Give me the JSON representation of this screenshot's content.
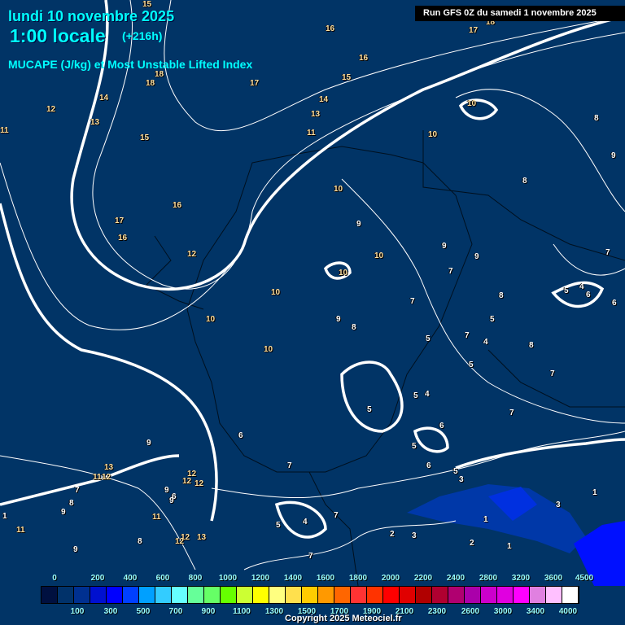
{
  "header": {
    "date": "lundi 10 novembre 2025",
    "time": "1:00 locale",
    "lead": "(+216h)",
    "parameter": "MUCAPE (J/kg) et Most Unstable Lifted Index",
    "run": "Run GFS 0Z du samedi 1 novembre 2025"
  },
  "map": {
    "labels": [
      "15",
      "16",
      "17",
      "18",
      "16",
      "15",
      "18",
      "18",
      "17",
      "14",
      "13",
      "14",
      "12",
      "13",
      "11",
      "11",
      "15",
      "10",
      "10",
      "8",
      "9",
      "8",
      "10",
      "16",
      "17",
      "16",
      "9",
      "12",
      "10",
      "9",
      "9",
      "10",
      "7",
      "7",
      "10",
      "7",
      "8",
      "5",
      "4",
      "6",
      "6",
      "10",
      "9",
      "8",
      "5",
      "5",
      "7",
      "4",
      "8",
      "10",
      "5",
      "7",
      "5",
      "4",
      "5",
      "7",
      "6",
      "9",
      "6",
      "5",
      "6",
      "7",
      "13",
      "11",
      "12",
      "12",
      "12",
      "12",
      "5",
      "3",
      "7",
      "8",
      "9",
      "6",
      "9",
      "9",
      "11",
      "3",
      "1",
      "1",
      "7",
      "4",
      "5",
      "2",
      "3",
      "8",
      "12",
      "13",
      "12",
      "11",
      "9",
      "2",
      "1",
      "7",
      "1"
    ]
  },
  "legend": {
    "colors": [
      "#001040",
      "#01326a",
      "#003090",
      "#0010d0",
      "#0000ff",
      "#0040ff",
      "#00a0ff",
      "#33ccff",
      "#66ffff",
      "#66ff99",
      "#66ff66",
      "#66ff00",
      "#ccff33",
      "#ffff00",
      "#ffff80",
      "#ffe04d",
      "#ffcc00",
      "#ff9900",
      "#ff6600",
      "#ff3333",
      "#ff3300",
      "#ff0000",
      "#e00000",
      "#b00000",
      "#b00030",
      "#b00070",
      "#aa00aa",
      "#cc00cc",
      "#e000e0",
      "#ff00ff",
      "#e080e0",
      "#ffc0ff",
      "#ffffff"
    ],
    "top_labels": [
      "0",
      "200",
      "400",
      "600",
      "800",
      "1000",
      "1200",
      "1400",
      "1600",
      "1800",
      "2000",
      "2200",
      "2400",
      "2800",
      "3200",
      "3600",
      "4500"
    ],
    "bottom_labels": [
      "100",
      "300",
      "500",
      "700",
      "900",
      "1100",
      "1300",
      "1500",
      "1700",
      "1900",
      "2100",
      "2300",
      "2600",
      "3000",
      "3400",
      "4000"
    ]
  },
  "copyright": "Copyright 2025 Meteociel.fr"
}
